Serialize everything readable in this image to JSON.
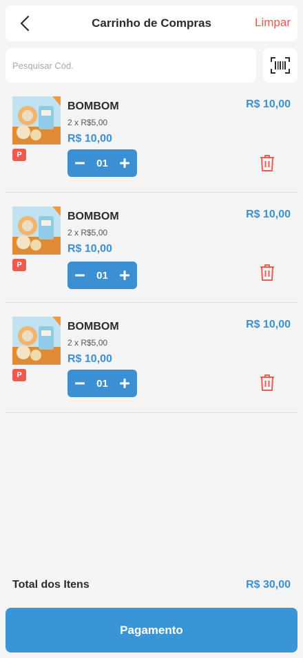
{
  "header": {
    "title": "Carrinho de Compras",
    "clear_label": "Limpar"
  },
  "search": {
    "placeholder": "Pesquisar Cód."
  },
  "cart": {
    "items": [
      {
        "name": "BOMBOM",
        "unit_price": "2 x R$5,00",
        "subtotal": "R$ 10,00",
        "total": "R$ 10,00",
        "quantity": "01",
        "badge": "P"
      },
      {
        "name": "BOMBOM",
        "unit_price": "2 x R$5,00",
        "subtotal": "R$ 10,00",
        "total": "R$ 10,00",
        "quantity": "01",
        "badge": "P"
      },
      {
        "name": "BOMBOM",
        "unit_price": "2 x R$5,00",
        "subtotal": "R$ 10,00",
        "total": "R$ 10,00",
        "quantity": "01",
        "badge": "P"
      }
    ]
  },
  "footer": {
    "total_label": "Total dos Itens",
    "total_value": "R$ 30,00",
    "pay_label": "Pagamento"
  },
  "icons": {
    "back": "chevron-left-icon",
    "scan": "barcode-scan-icon",
    "minus": "minus-icon",
    "plus": "plus-icon",
    "trash": "trash-icon"
  },
  "colors": {
    "accent": "#3a90d3",
    "danger": "#e8574b",
    "background": "#f4f4f5"
  }
}
